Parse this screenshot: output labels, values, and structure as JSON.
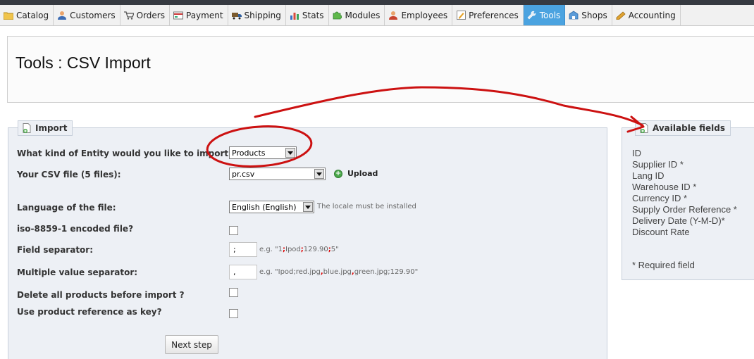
{
  "tabs": [
    {
      "label": "Catalog",
      "icon": "folder-icon"
    },
    {
      "label": "Customers",
      "icon": "customers-icon"
    },
    {
      "label": "Orders",
      "icon": "cart-icon"
    },
    {
      "label": "Payment",
      "icon": "payment-icon"
    },
    {
      "label": "Shipping",
      "icon": "truck-icon"
    },
    {
      "label": "Stats",
      "icon": "stats-icon"
    },
    {
      "label": "Modules",
      "icon": "puzzle-icon"
    },
    {
      "label": "Employees",
      "icon": "employee-icon"
    },
    {
      "label": "Preferences",
      "icon": "preferences-icon"
    },
    {
      "label": "Tools",
      "icon": "wrench-icon"
    },
    {
      "label": "Shops",
      "icon": "shop-icon"
    },
    {
      "label": "Accounting",
      "icon": "accounting-icon"
    }
  ],
  "active_tab": "Tools",
  "page_title": "Tools : CSV Import",
  "import": {
    "legend": "Import",
    "entity_label": "What kind of Entity would you like to import ?",
    "entity_value": "Products",
    "file_label": "Your CSV file (5 files):",
    "file_value": "pr.csv",
    "upload_label": "Upload",
    "language_label": "Language of the file:",
    "language_value": "English (English)",
    "language_hint": "The locale must be installed",
    "encoding_label": "iso-8859-1 encoded file?",
    "separator_label": "Field separator:",
    "separator_value": ";",
    "separator_hint": {
      "prefix": "e.g. \"1",
      "s1": ";",
      "mid1": "Ipod",
      "s2": ";",
      "mid2": "129.90",
      "s3": ";",
      "suffix": "5\""
    },
    "multi_label": "Multiple value separator:",
    "multi_value": ",",
    "multi_hint": {
      "prefix": "e.g. \"Ipod;red.jpg",
      "s1": ",",
      "mid1": "blue.jpg",
      "s2": ",",
      "suffix": "green.jpg;129.90\""
    },
    "delete_label": "Delete all products before import ?",
    "reference_label": "Use product reference as key?",
    "next_label": "Next step"
  },
  "available": {
    "legend": "Available fields",
    "fields": [
      "ID",
      "Supplier ID *",
      "Lang ID",
      "Warehouse ID *",
      "Currency ID *",
      "Supply Order Reference *",
      "Delivery Date (Y-M-D)*",
      "Discount Rate"
    ],
    "required_note": "* Required field"
  },
  "colors": {
    "active_tab": "#4ba3e0",
    "annotation": "#cc1111",
    "panel_bg": "#edf0f5"
  }
}
